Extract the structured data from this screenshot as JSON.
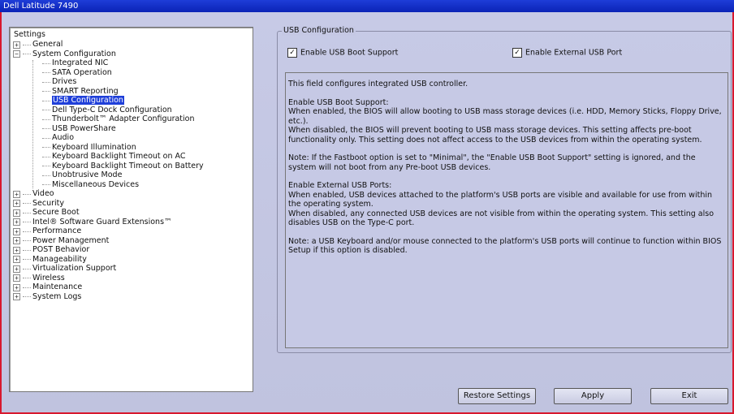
{
  "window": {
    "title": "Dell Latitude 7490"
  },
  "tree": {
    "root": "Settings",
    "items": [
      {
        "label": "General",
        "level": 1,
        "expander": "+",
        "selected": false
      },
      {
        "label": "System Configuration",
        "level": 1,
        "expander": "−",
        "selected": false
      },
      {
        "label": "Integrated NIC",
        "level": 2,
        "selected": false
      },
      {
        "label": "SATA Operation",
        "level": 2,
        "selected": false
      },
      {
        "label": "Drives",
        "level": 2,
        "selected": false
      },
      {
        "label": "SMART Reporting",
        "level": 2,
        "selected": false
      },
      {
        "label": "USB Configuration",
        "level": 2,
        "selected": true
      },
      {
        "label": "Dell Type-C Dock Configuration",
        "level": 2,
        "selected": false
      },
      {
        "label": "Thunderbolt™ Adapter Configuration",
        "level": 2,
        "selected": false
      },
      {
        "label": "USB PowerShare",
        "level": 2,
        "selected": false
      },
      {
        "label": "Audio",
        "level": 2,
        "selected": false
      },
      {
        "label": "Keyboard Illumination",
        "level": 2,
        "selected": false
      },
      {
        "label": "Keyboard Backlight Timeout on AC",
        "level": 2,
        "selected": false
      },
      {
        "label": "Keyboard Backlight Timeout on Battery",
        "level": 2,
        "selected": false
      },
      {
        "label": "Unobtrusive Mode",
        "level": 2,
        "selected": false
      },
      {
        "label": "Miscellaneous Devices",
        "level": 2,
        "selected": false
      },
      {
        "label": "Video",
        "level": 1,
        "expander": "+",
        "selected": false
      },
      {
        "label": "Security",
        "level": 1,
        "expander": "+",
        "selected": false
      },
      {
        "label": "Secure Boot",
        "level": 1,
        "expander": "+",
        "selected": false
      },
      {
        "label": "Intel® Software Guard Extensions™",
        "level": 1,
        "expander": "+",
        "selected": false
      },
      {
        "label": "Performance",
        "level": 1,
        "expander": "+",
        "selected": false
      },
      {
        "label": "Power Management",
        "level": 1,
        "expander": "+",
        "selected": false
      },
      {
        "label": "POST Behavior",
        "level": 1,
        "expander": "+",
        "selected": false
      },
      {
        "label": "Manageability",
        "level": 1,
        "expander": "+",
        "selected": false
      },
      {
        "label": "Virtualization Support",
        "level": 1,
        "expander": "+",
        "selected": false
      },
      {
        "label": "Wireless",
        "level": 1,
        "expander": "+",
        "selected": false
      },
      {
        "label": "Maintenance",
        "level": 1,
        "expander": "+",
        "selected": false
      },
      {
        "label": "System Logs",
        "level": 1,
        "expander": "+",
        "selected": false
      }
    ]
  },
  "panel": {
    "title": "USB Configuration",
    "boot_support": {
      "label": "Enable USB Boot Support",
      "checked": true,
      "mark": "✓"
    },
    "external_port": {
      "label": "Enable External USB Port",
      "checked": true,
      "mark": "✓"
    },
    "description": [
      "This field configures integrated USB controller.",
      "Enable USB Boot Support:\nWhen enabled, the BIOS will allow booting to USB mass storage devices (i.e. HDD, Memory Sticks, Floppy Drive, etc.).\nWhen disabled, the BIOS will prevent booting to USB mass storage devices. This setting affects pre-boot functionality only. This setting does not affect access to the USB devices from within the operating system.",
      "Note:  If the Fastboot option is set to \"Minimal\", the \"Enable USB Boot Support\" setting is ignored, and the system will not boot from any Pre-boot USB devices.",
      "Enable External USB Ports:\nWhen enabled, USB devices attached to the platform's USB ports are visible and available for use from within the operating system.\nWhen disabled, any connected USB devices are not visible from within the operating system. This setting also disables USB on the Type-C port.",
      "Note: a USB Keyboard and/or mouse connected to the platform's USB ports will continue to function within BIOS Setup if this option is disabled."
    ]
  },
  "buttons": {
    "restore": "Restore Settings",
    "apply": "Apply",
    "exit": "Exit"
  },
  "colors": {
    "titlebar": "#1e3dd8",
    "frame_border": "#d8182e",
    "selection": "#1f3fd9",
    "background": "#c3c6e3"
  }
}
